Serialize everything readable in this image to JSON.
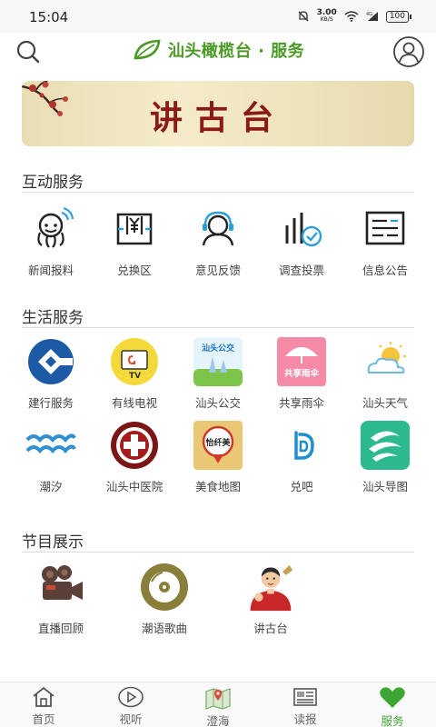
{
  "status_bar": {
    "time": "15:04",
    "speed_value": "3.00",
    "speed_unit": "KB/S",
    "battery": "100"
  },
  "header": {
    "title": "汕头橄榄台 · 服务"
  },
  "banner": {
    "text": "讲古台"
  },
  "sections": {
    "interactive": {
      "title": "互动服务",
      "items": [
        {
          "label": "新闻报料",
          "icon": "news-report-icon"
        },
        {
          "label": "兑换区",
          "icon": "redeem-icon"
        },
        {
          "label": "意见反馈",
          "icon": "feedback-icon"
        },
        {
          "label": "调查投票",
          "icon": "survey-vote-icon"
        },
        {
          "label": "信息公告",
          "icon": "notice-icon"
        }
      ]
    },
    "life": {
      "title": "生活服务",
      "items": [
        {
          "label": "建行服务",
          "icon": "ccb-icon"
        },
        {
          "label": "有线电视",
          "icon": "cable-tv-icon"
        },
        {
          "label": "汕头公交",
          "icon": "bus-icon",
          "icon_text": "汕头公交"
        },
        {
          "label": "共享雨伞",
          "icon": "umbrella-icon",
          "icon_text": "共享雨伞"
        },
        {
          "label": "汕头天气",
          "icon": "weather-icon"
        },
        {
          "label": "潮汐",
          "icon": "tide-icon"
        },
        {
          "label": "汕头中医院",
          "icon": "tcm-hospital-icon"
        },
        {
          "label": "美食地图",
          "icon": "food-map-icon",
          "icon_text": "怡纤美"
        },
        {
          "label": "兑吧",
          "icon": "duiba-icon"
        },
        {
          "label": "汕头导图",
          "icon": "map-guide-icon"
        }
      ]
    },
    "programs": {
      "title": "节目展示",
      "items": [
        {
          "label": "直播回顾",
          "icon": "camera-icon"
        },
        {
          "label": "潮语歌曲",
          "icon": "music-disc-icon"
        },
        {
          "label": "讲古台",
          "icon": "storyteller-icon"
        }
      ]
    }
  },
  "bottom_nav": [
    {
      "label": "首页",
      "icon": "home-icon"
    },
    {
      "label": "视听",
      "icon": "play-icon"
    },
    {
      "label": "澄海",
      "icon": "map-icon"
    },
    {
      "label": "读报",
      "icon": "newspaper-icon"
    },
    {
      "label": "服务",
      "icon": "heart-icon",
      "active": true
    }
  ],
  "colors": {
    "brand_green": "#4a9a25",
    "active_nav": "#3fa535",
    "banner_red": "#8a1a14"
  }
}
